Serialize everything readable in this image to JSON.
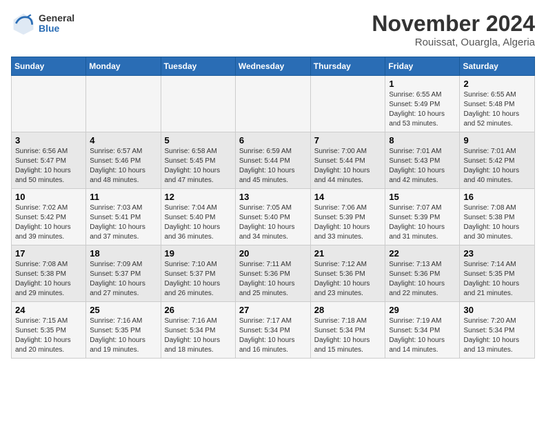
{
  "logo": {
    "general": "General",
    "blue": "Blue"
  },
  "title": "November 2024",
  "subtitle": "Rouissat, Ouargla, Algeria",
  "days_header": [
    "Sunday",
    "Monday",
    "Tuesday",
    "Wednesday",
    "Thursday",
    "Friday",
    "Saturday"
  ],
  "weeks": [
    [
      {
        "day": "",
        "info": ""
      },
      {
        "day": "",
        "info": ""
      },
      {
        "day": "",
        "info": ""
      },
      {
        "day": "",
        "info": ""
      },
      {
        "day": "",
        "info": ""
      },
      {
        "day": "1",
        "info": "Sunrise: 6:55 AM\nSunset: 5:49 PM\nDaylight: 10 hours\nand 53 minutes."
      },
      {
        "day": "2",
        "info": "Sunrise: 6:55 AM\nSunset: 5:48 PM\nDaylight: 10 hours\nand 52 minutes."
      }
    ],
    [
      {
        "day": "3",
        "info": "Sunrise: 6:56 AM\nSunset: 5:47 PM\nDaylight: 10 hours\nand 50 minutes."
      },
      {
        "day": "4",
        "info": "Sunrise: 6:57 AM\nSunset: 5:46 PM\nDaylight: 10 hours\nand 48 minutes."
      },
      {
        "day": "5",
        "info": "Sunrise: 6:58 AM\nSunset: 5:45 PM\nDaylight: 10 hours\nand 47 minutes."
      },
      {
        "day": "6",
        "info": "Sunrise: 6:59 AM\nSunset: 5:44 PM\nDaylight: 10 hours\nand 45 minutes."
      },
      {
        "day": "7",
        "info": "Sunrise: 7:00 AM\nSunset: 5:44 PM\nDaylight: 10 hours\nand 44 minutes."
      },
      {
        "day": "8",
        "info": "Sunrise: 7:01 AM\nSunset: 5:43 PM\nDaylight: 10 hours\nand 42 minutes."
      },
      {
        "day": "9",
        "info": "Sunrise: 7:01 AM\nSunset: 5:42 PM\nDaylight: 10 hours\nand 40 minutes."
      }
    ],
    [
      {
        "day": "10",
        "info": "Sunrise: 7:02 AM\nSunset: 5:42 PM\nDaylight: 10 hours\nand 39 minutes."
      },
      {
        "day": "11",
        "info": "Sunrise: 7:03 AM\nSunset: 5:41 PM\nDaylight: 10 hours\nand 37 minutes."
      },
      {
        "day": "12",
        "info": "Sunrise: 7:04 AM\nSunset: 5:40 PM\nDaylight: 10 hours\nand 36 minutes."
      },
      {
        "day": "13",
        "info": "Sunrise: 7:05 AM\nSunset: 5:40 PM\nDaylight: 10 hours\nand 34 minutes."
      },
      {
        "day": "14",
        "info": "Sunrise: 7:06 AM\nSunset: 5:39 PM\nDaylight: 10 hours\nand 33 minutes."
      },
      {
        "day": "15",
        "info": "Sunrise: 7:07 AM\nSunset: 5:39 PM\nDaylight: 10 hours\nand 31 minutes."
      },
      {
        "day": "16",
        "info": "Sunrise: 7:08 AM\nSunset: 5:38 PM\nDaylight: 10 hours\nand 30 minutes."
      }
    ],
    [
      {
        "day": "17",
        "info": "Sunrise: 7:08 AM\nSunset: 5:38 PM\nDaylight: 10 hours\nand 29 minutes."
      },
      {
        "day": "18",
        "info": "Sunrise: 7:09 AM\nSunset: 5:37 PM\nDaylight: 10 hours\nand 27 minutes."
      },
      {
        "day": "19",
        "info": "Sunrise: 7:10 AM\nSunset: 5:37 PM\nDaylight: 10 hours\nand 26 minutes."
      },
      {
        "day": "20",
        "info": "Sunrise: 7:11 AM\nSunset: 5:36 PM\nDaylight: 10 hours\nand 25 minutes."
      },
      {
        "day": "21",
        "info": "Sunrise: 7:12 AM\nSunset: 5:36 PM\nDaylight: 10 hours\nand 23 minutes."
      },
      {
        "day": "22",
        "info": "Sunrise: 7:13 AM\nSunset: 5:36 PM\nDaylight: 10 hours\nand 22 minutes."
      },
      {
        "day": "23",
        "info": "Sunrise: 7:14 AM\nSunset: 5:35 PM\nDaylight: 10 hours\nand 21 minutes."
      }
    ],
    [
      {
        "day": "24",
        "info": "Sunrise: 7:15 AM\nSunset: 5:35 PM\nDaylight: 10 hours\nand 20 minutes."
      },
      {
        "day": "25",
        "info": "Sunrise: 7:16 AM\nSunset: 5:35 PM\nDaylight: 10 hours\nand 19 minutes."
      },
      {
        "day": "26",
        "info": "Sunrise: 7:16 AM\nSunset: 5:34 PM\nDaylight: 10 hours\nand 18 minutes."
      },
      {
        "day": "27",
        "info": "Sunrise: 7:17 AM\nSunset: 5:34 PM\nDaylight: 10 hours\nand 16 minutes."
      },
      {
        "day": "28",
        "info": "Sunrise: 7:18 AM\nSunset: 5:34 PM\nDaylight: 10 hours\nand 15 minutes."
      },
      {
        "day": "29",
        "info": "Sunrise: 7:19 AM\nSunset: 5:34 PM\nDaylight: 10 hours\nand 14 minutes."
      },
      {
        "day": "30",
        "info": "Sunrise: 7:20 AM\nSunset: 5:34 PM\nDaylight: 10 hours\nand 13 minutes."
      }
    ]
  ]
}
